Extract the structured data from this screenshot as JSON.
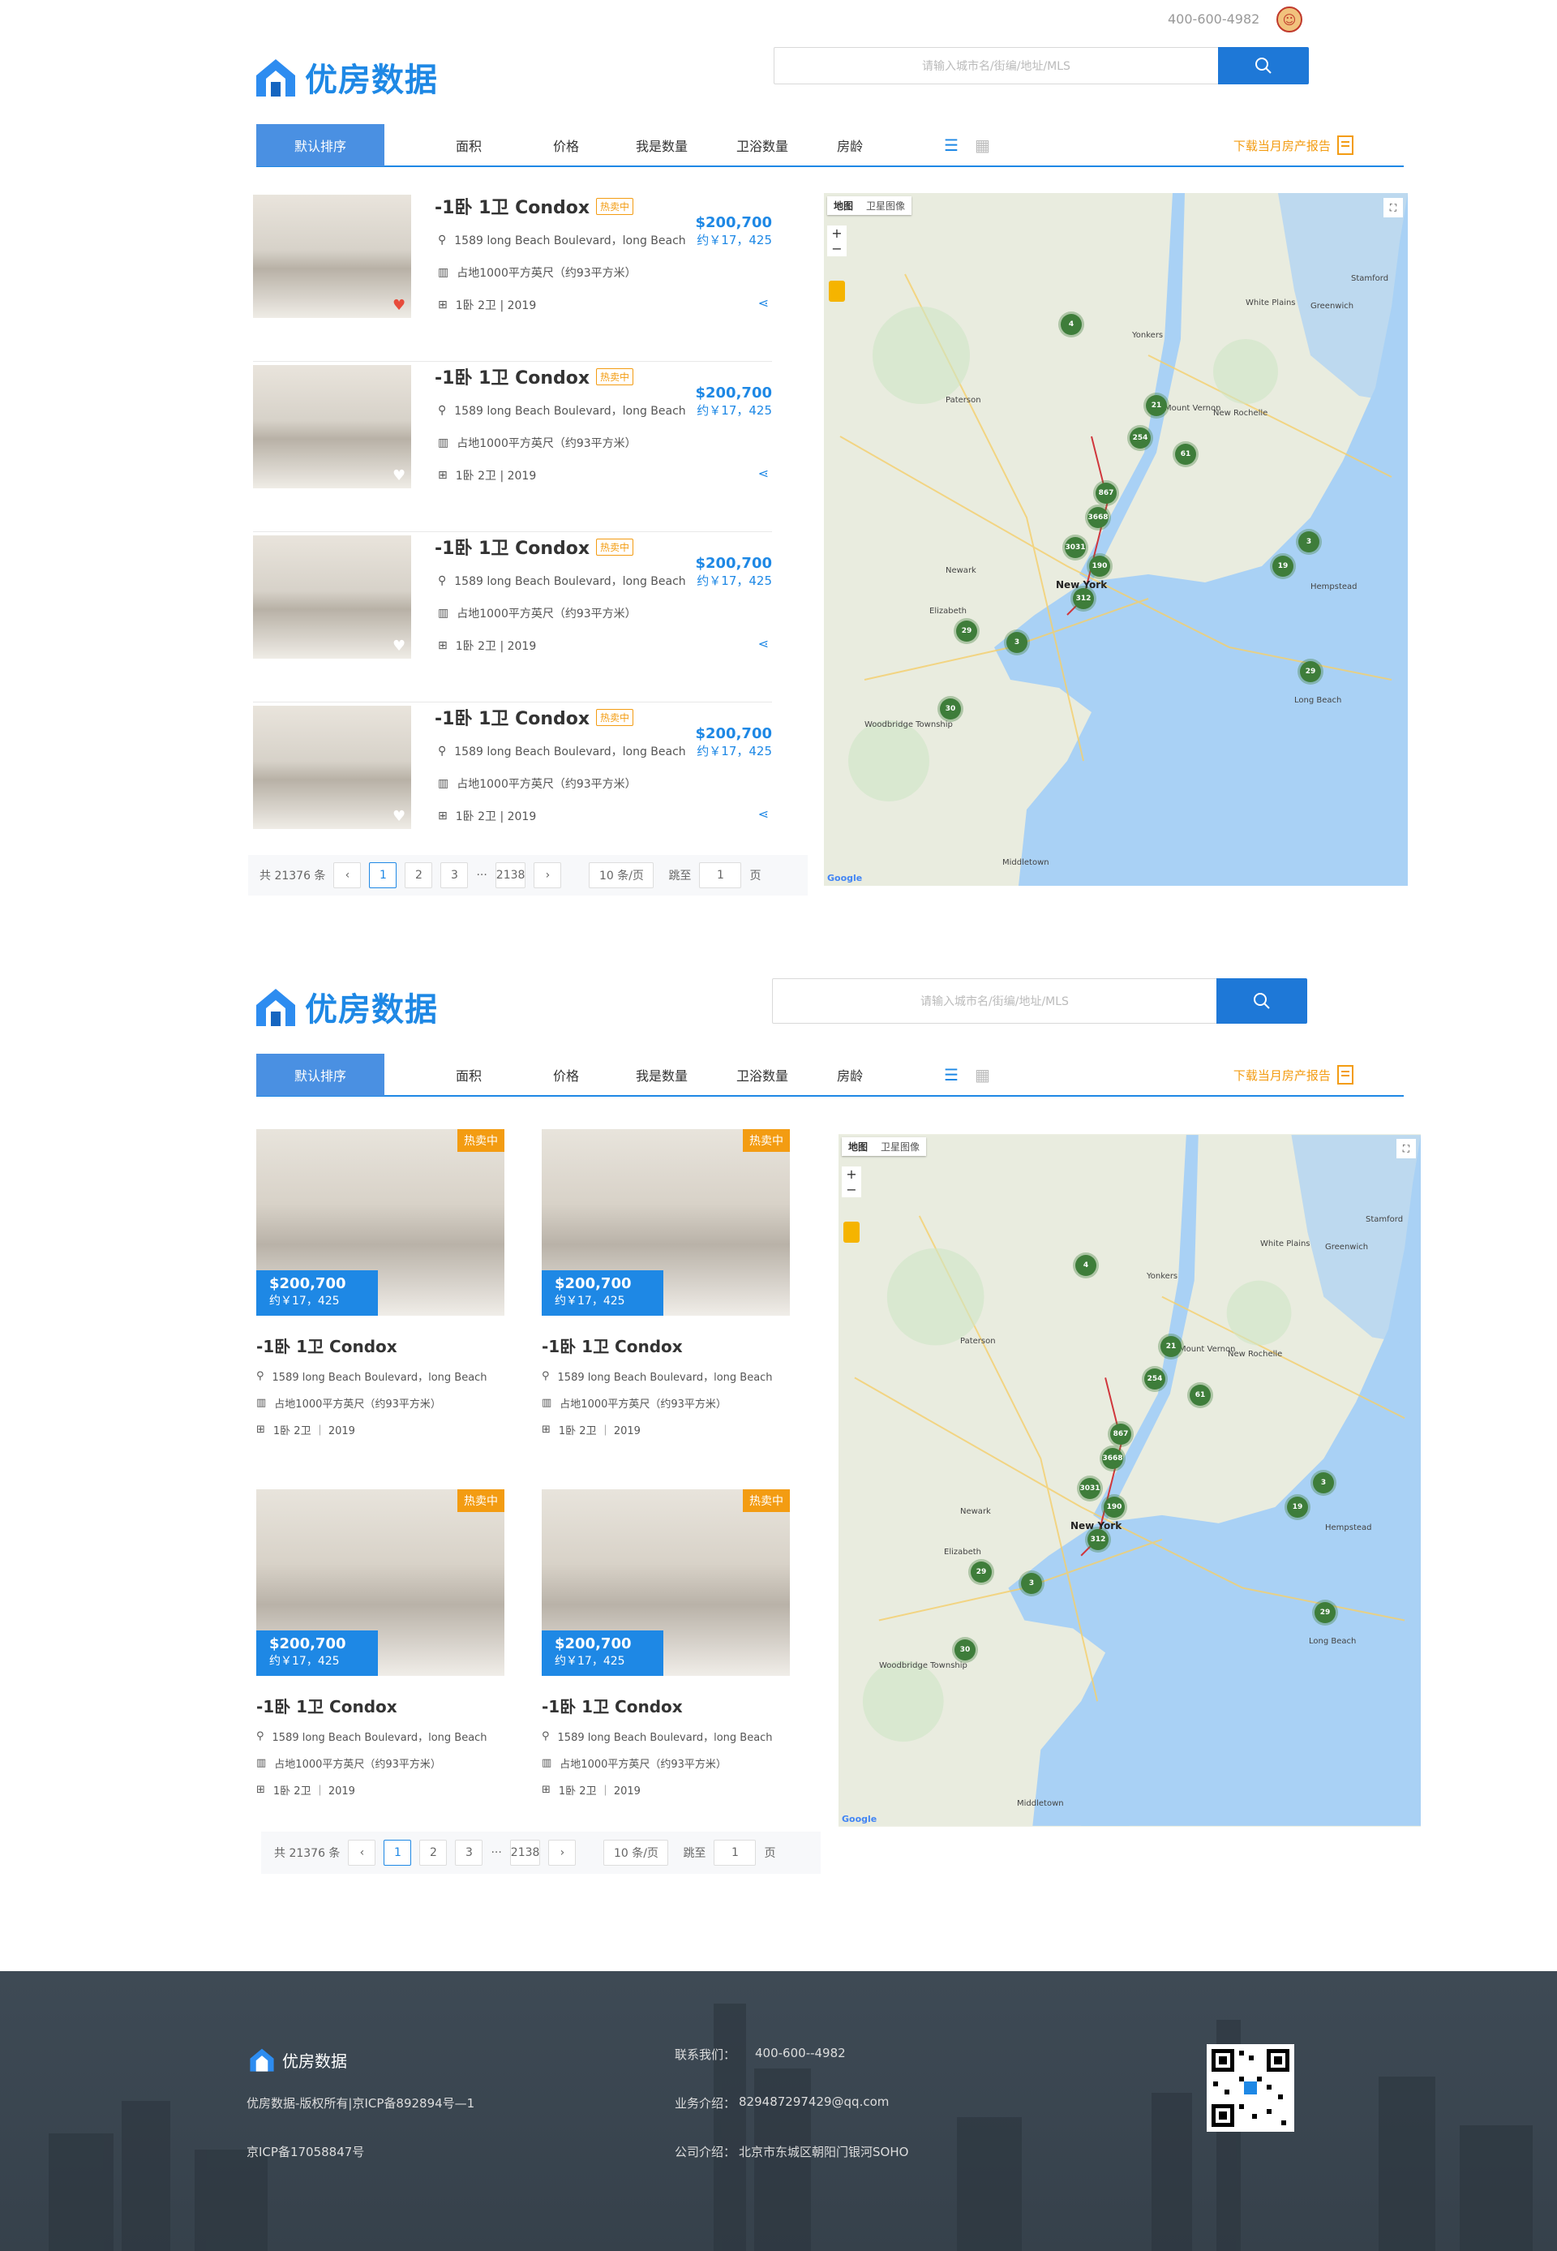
{
  "topbar": {
    "phone": "400-600-4982"
  },
  "brand": {
    "name": "优房数据"
  },
  "search": {
    "placeholder": "请输入城市名/街编/地址/MLS"
  },
  "nav": {
    "active": "默认排序",
    "items": [
      "面积",
      "价格",
      "我是数量",
      "卫浴数量",
      "房龄"
    ],
    "report": "下载当月房产报告"
  },
  "listing": {
    "title": "-1卧 1卫 Condox",
    "hot": "热卖中",
    "address": "1589 long Beach Boulevard，long Beach",
    "area": "占地1000平方英尺（约93平方米）",
    "rooms": "1卧 2卫 | 2019",
    "rooms_grid": "1卧 2卫 ｜ 2019",
    "price": "$200,700",
    "price_rmb": "约￥17，425"
  },
  "pager": {
    "total": "共 21376 条",
    "prev": "‹",
    "next": "›",
    "pages": [
      "1",
      "2",
      "3"
    ],
    "ellipsis": "···",
    "last": "2138",
    "per_page": "10 条/页",
    "jump": "跳至",
    "jump_value": "1",
    "page_unit": "页"
  },
  "map": {
    "tab_map": "地图",
    "tab_sat": "卫星图像",
    "zoom_in": "+",
    "zoom_out": "−",
    "google": "Google",
    "city": "New York",
    "places": [
      "Yonkers",
      "Paterson",
      "Newark",
      "Elizabeth",
      "Mount Vernon",
      "New Rochelle",
      "White Plains",
      "Hempstead",
      "Stamford",
      "Greenwich",
      "Woodbridge Township",
      "Middletown",
      "Long Beach"
    ],
    "clusters": [
      "4",
      "21",
      "254",
      "61",
      "867",
      "3668",
      "3031",
      "312",
      "190",
      "3",
      "19",
      "29",
      "3",
      "29",
      "30"
    ]
  },
  "footer": {
    "brand": "优房数据",
    "copyright": "优房数据-版权所有|京ICP备892894号—1",
    "icp": "京ICP备17058847号",
    "contact_label": "联系我们：",
    "contact_value": "400-600--4982",
    "biz_label": "业务介绍：",
    "biz_value": "829487297429@qq.com",
    "addr_label": "公司介绍：",
    "addr_value": "北京市东城区朝阳门银河SOHO"
  },
  "colors": {
    "primary": "#1e88e5",
    "orange": "#f39c12",
    "cluster": "#3e7d3a"
  }
}
